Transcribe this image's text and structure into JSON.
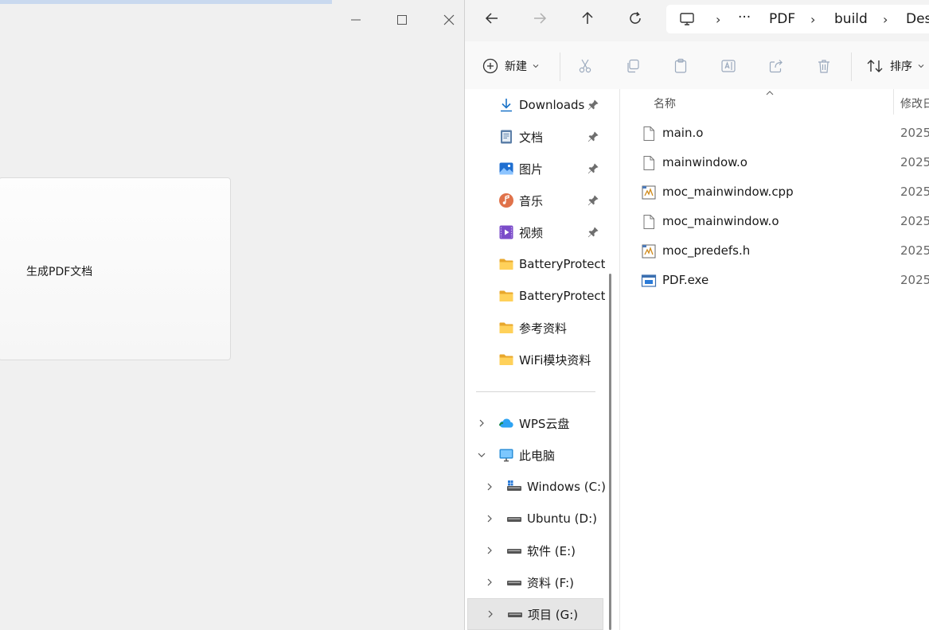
{
  "app": {
    "button_label": "生成PDF文档"
  },
  "explorer": {
    "breadcrumb": [
      "PDF",
      "build",
      "Des"
    ],
    "breadcrumb_more": "···",
    "toolbar": {
      "new_label": "新建",
      "sort_label": "排序"
    },
    "nav_items": [
      {
        "label": "Downloads",
        "icon": "download-icon",
        "pinned": true
      },
      {
        "label": "文档",
        "icon": "document-icon",
        "pinned": true
      },
      {
        "label": "图片",
        "icon": "pictures-icon",
        "pinned": true
      },
      {
        "label": "音乐",
        "icon": "music-icon",
        "pinned": true
      },
      {
        "label": "视频",
        "icon": "video-icon",
        "pinned": true
      },
      {
        "label": "BatteryProtect",
        "icon": "folder-icon",
        "pinned": false
      },
      {
        "label": "BatteryProtect",
        "icon": "folder-icon",
        "pinned": false
      },
      {
        "label": "参考资料",
        "icon": "folder-icon",
        "pinned": false
      },
      {
        "label": "WiFi模块资料",
        "icon": "folder-icon",
        "pinned": false
      }
    ],
    "tree_items": [
      {
        "label": "WPS云盘",
        "icon": "cloud-icon",
        "expanded": false
      },
      {
        "label": "此电脑",
        "icon": "computer-icon",
        "expanded": true
      },
      {
        "label": "Windows (C:)",
        "icon": "windows-drive-icon",
        "expanded": false
      },
      {
        "label": "Ubuntu (D:)",
        "icon": "drive-icon",
        "expanded": false
      },
      {
        "label": "软件 (E:)",
        "icon": "drive-icon",
        "expanded": false
      },
      {
        "label": "资料 (F:)",
        "icon": "drive-icon",
        "expanded": false
      },
      {
        "label": "项目 (G:)",
        "icon": "drive-icon",
        "expanded": false,
        "selected": true
      }
    ],
    "columns": {
      "name": "名称",
      "modified": "修改日"
    },
    "files": [
      {
        "name": "main.o",
        "date": "2025/",
        "icon": "blank-file-icon"
      },
      {
        "name": "mainwindow.o",
        "date": "2025/",
        "icon": "blank-file-icon"
      },
      {
        "name": "moc_mainwindow.cpp",
        "date": "2025/",
        "icon": "code-file-icon"
      },
      {
        "name": "moc_mainwindow.o",
        "date": "2025/",
        "icon": "blank-file-icon"
      },
      {
        "name": "moc_predefs.h",
        "date": "2025/",
        "icon": "code-file-icon"
      },
      {
        "name": "PDF.exe",
        "date": "2025/",
        "icon": "exe-file-icon"
      }
    ]
  }
}
